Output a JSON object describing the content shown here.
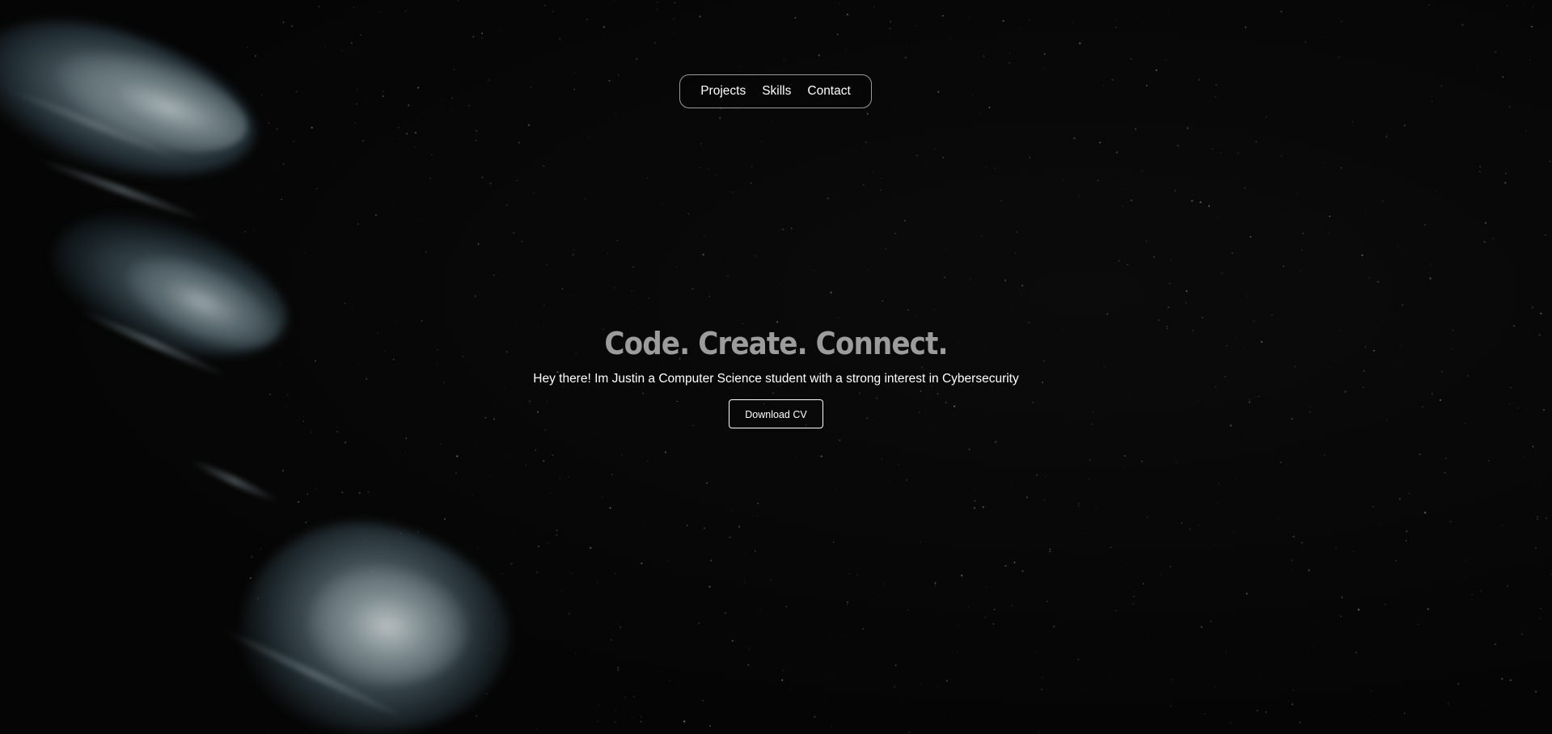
{
  "nav": {
    "items": [
      {
        "label": "Projects"
      },
      {
        "label": "Skills"
      },
      {
        "label": "Contact"
      }
    ]
  },
  "hero": {
    "title": "Code. Create. Connect.",
    "subtitle": "Hey there! Im Justin a Computer Science student with a strong interest in Cybersecurity",
    "cv_button_label": "Download CV"
  },
  "colors": {
    "background": "#050505",
    "title": "#9c9c9c",
    "text": "#ffffff",
    "nav_border": "#9a9a9a"
  }
}
